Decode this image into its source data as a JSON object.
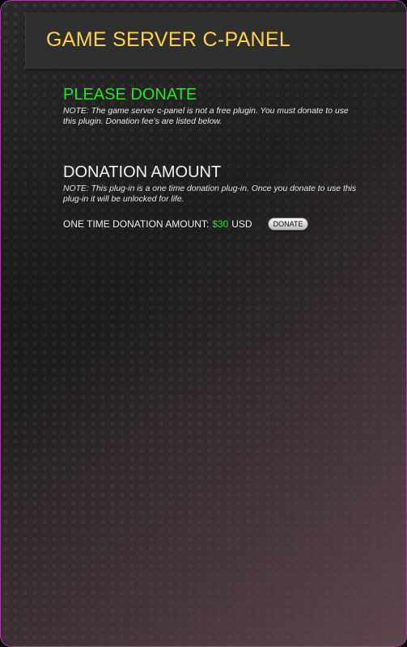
{
  "header": {
    "title": "GAME SERVER C-PANEL"
  },
  "donate_section": {
    "title": "PLEASE DONATE",
    "note": "NOTE: The game server c-panel is not a free plugin. You must donate to use this plugin. Donation fee’s are listed below."
  },
  "donation_amount": {
    "title": "DONATION AMOUNT",
    "note": "NOTE: This plug-in is a one time donation plug-in. Once you donate to use this plug-in it will be unlocked for life.",
    "label": "ONE TIME DONATION AMOUNT:",
    "value": "$30",
    "currency": "USD",
    "button_label": "DONATE"
  },
  "colors": {
    "header_title": "#ffd34d",
    "accent_green": "#22e81e",
    "frame_border": "#a83aa8"
  }
}
